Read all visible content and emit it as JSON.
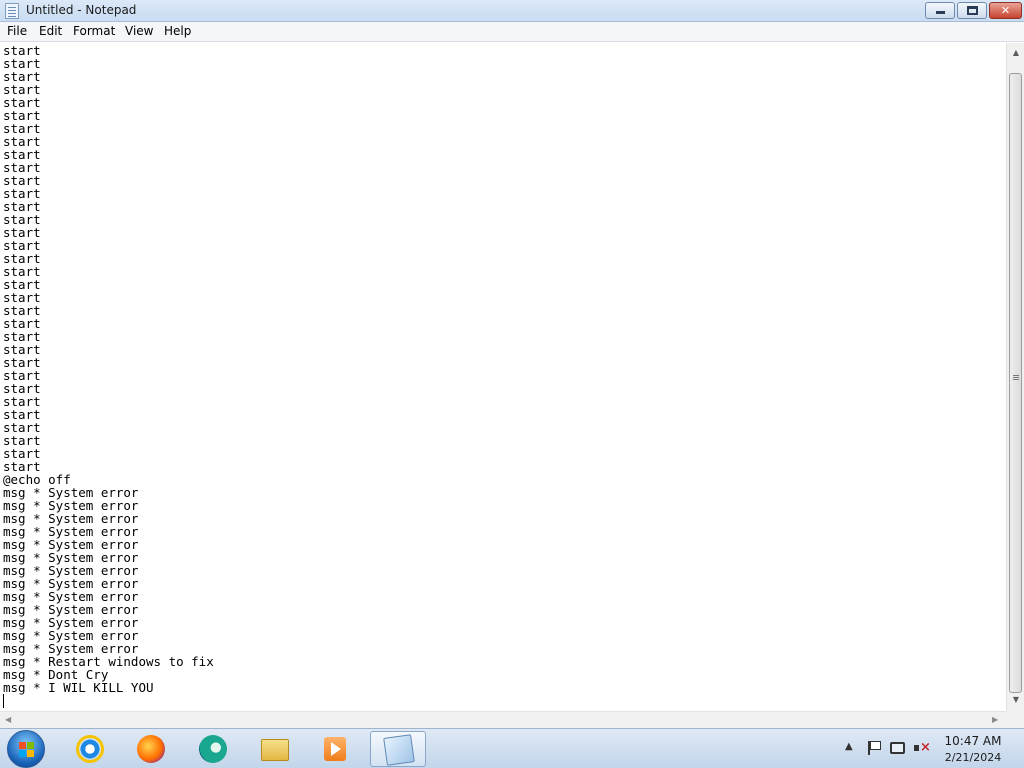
{
  "window": {
    "title": "Untitled - Notepad",
    "controls": {
      "minimize_icon": "minimize-icon",
      "restore_icon": "restore-icon",
      "close_glyph": "✕"
    }
  },
  "menu": [
    "File",
    "Edit",
    "Format",
    "View",
    "Help"
  ],
  "editor": {
    "lines": [
      "start",
      "start",
      "start",
      "start",
      "start",
      "start",
      "start",
      "start",
      "start",
      "start",
      "start",
      "start",
      "start",
      "start",
      "start",
      "start",
      "start",
      "start",
      "start",
      "start",
      "start",
      "start",
      "start",
      "start",
      "start",
      "start",
      "start",
      "start",
      "start",
      "start",
      "start",
      "start",
      "start",
      "@echo off",
      "msg * System error",
      "msg * System error",
      "msg * System error",
      "msg * System error",
      "msg * System error",
      "msg * System error",
      "msg * System error",
      "msg * System error",
      "msg * System error",
      "msg * System error",
      "msg * System error",
      "msg * System error",
      "msg * System error",
      "msg * Restart windows to fix",
      "msg * Dont Cry",
      "msg * I WIL KILL YOU"
    ]
  },
  "taskbar": {
    "start_icon": "windows-start-orb",
    "pinned": [
      "internet-explorer-icon",
      "firefox-icon",
      "edge-icon",
      "file-explorer-icon",
      "media-player-icon",
      "notepad-icon"
    ],
    "active": "notepad-icon"
  },
  "tray": {
    "time": "10:47 AM",
    "date": "2/21/2024",
    "chevron": "▲",
    "icons": [
      "action-center-flag-icon",
      "network-icon",
      "speaker-muted-icon"
    ]
  }
}
